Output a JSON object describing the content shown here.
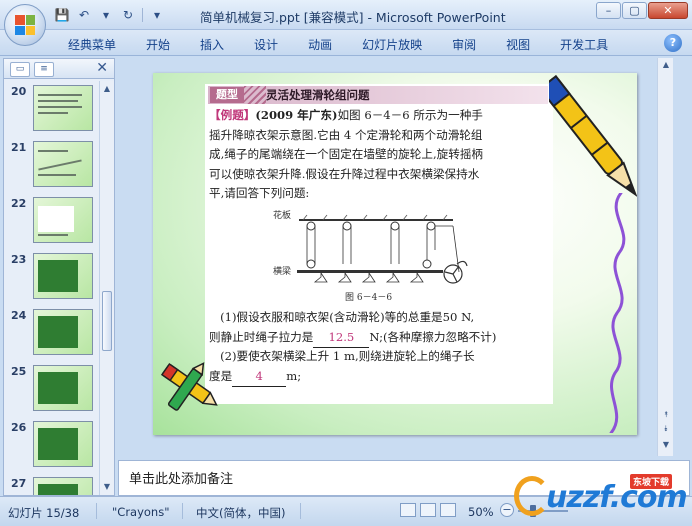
{
  "window": {
    "title": "简单机械复习.ppt [兼容模式] - Microsoft PowerPoint",
    "minimize": "–",
    "maximize": "▢",
    "close": "✕"
  },
  "ribbon": {
    "tabs": [
      "经典菜单",
      "开始",
      "插入",
      "设计",
      "动画",
      "幻灯片放映",
      "审阅",
      "视图",
      "开发工具"
    ],
    "help": "?"
  },
  "pane": {
    "close": "✕",
    "slides": [
      {
        "num": "20",
        "style": "text"
      },
      {
        "num": "21",
        "style": "diagram"
      },
      {
        "num": "22",
        "style": "content"
      },
      {
        "num": "23",
        "style": "green"
      },
      {
        "num": "24",
        "style": "green"
      },
      {
        "num": "25",
        "style": "green"
      },
      {
        "num": "26",
        "style": "green"
      },
      {
        "num": "27",
        "style": "green"
      }
    ]
  },
  "slide": {
    "tag": "题型",
    "heading": "灵活处理滑轮组问题",
    "example_label": "【例题】",
    "example_source": "(2009 年广东)",
    "lines": [
      "如图 6－4－6 所示为一种手",
      "摇升降晾衣架示意图.它由 4 个定滑轮和两个动滑轮组",
      "成,绳子的尾端绕在一个固定在墙壁的旋轮上,旋转摇柄",
      "可以使晾衣架升降.假设在升降过程中衣架横梁保持水",
      "平,请回答下列问题:"
    ],
    "figure": {
      "ceiling_label": "花板",
      "beam_label": "横梁",
      "caption": "图 6－4－6"
    },
    "q1_a": "(1)假设衣服和晾衣架(含动滑轮)等的总重是50 N,",
    "q1_b_pre": "则静止时绳子拉力是",
    "q1_answer": "12.5",
    "q1_b_post": "N;(各种摩擦力忽略不计)",
    "q2_a": "(2)要使衣架横梁上升 1 m,则绕进旋轮上的绳子长",
    "q2_b_pre": "度是",
    "q2_answer": "4",
    "q2_b_post": "m;"
  },
  "notes": {
    "placeholder": "单击此处添加备注"
  },
  "status": {
    "slide": "幻灯片 15/38",
    "theme": "\"Crayons\"",
    "language": "中文(简体，中国)",
    "zoom": "50%"
  },
  "watermark": {
    "text": "uzzf.com",
    "badge": "东坡下载"
  }
}
